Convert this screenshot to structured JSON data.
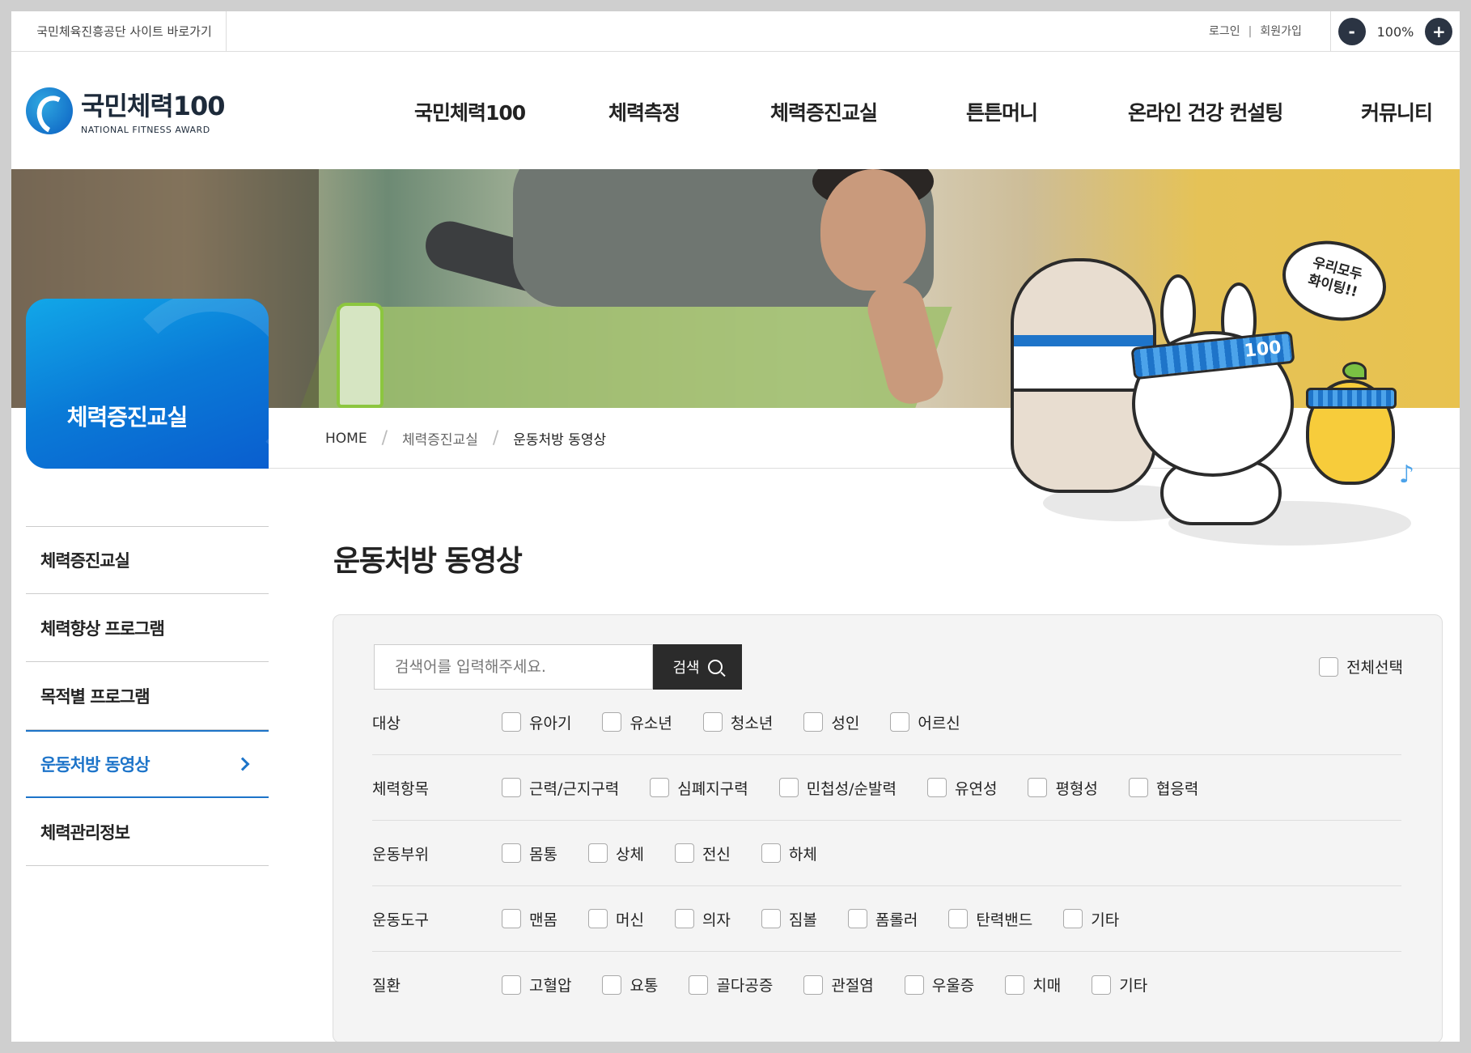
{
  "util": {
    "family_link": "국민체육진흥공단 사이트 바로가기",
    "login": "로그인",
    "separator": "|",
    "join": "회원가입",
    "zoom_out": "-",
    "zoom_level": "100%",
    "zoom_in": "+"
  },
  "logo": {
    "title": "국민체력100",
    "subtitle": "NATIONAL FITNESS AWARD"
  },
  "gnb": [
    "국민체력100",
    "체력측정",
    "체력증진교실",
    "튼튼머니",
    "온라인 건강 컨설팅",
    "커뮤니티"
  ],
  "visual": {
    "bubble_line1": "우리모두",
    "bubble_line2": "화이팅!!",
    "headband_text": "100"
  },
  "section_title": "체력증진교실",
  "breadcrumb": {
    "home": "HOME",
    "mid": "체력증진교실",
    "current": "운동처방 동영상"
  },
  "lnb": [
    {
      "label": "체력증진교실",
      "active": false
    },
    {
      "label": "체력향상 프로그램",
      "active": false
    },
    {
      "label": "목적별 프로그램",
      "active": false
    },
    {
      "label": "운동처방 동영상",
      "active": true
    },
    {
      "label": "체력관리정보",
      "active": false
    }
  ],
  "page_title": "운동처방 동영상",
  "search": {
    "placeholder": "검색어를 입력해주세요.",
    "button": "검색",
    "select_all": "전체선택"
  },
  "filters": [
    {
      "label": "대상",
      "options": [
        "유아기",
        "유소년",
        "청소년",
        "성인",
        "어르신"
      ]
    },
    {
      "label": "체력항목",
      "options": [
        "근력/근지구력",
        "심폐지구력",
        "민첩성/순발력",
        "유연성",
        "평형성",
        "협응력"
      ]
    },
    {
      "label": "운동부위",
      "options": [
        "몸통",
        "상체",
        "전신",
        "하체"
      ]
    },
    {
      "label": "운동도구",
      "options": [
        "맨몸",
        "머신",
        "의자",
        "짐볼",
        "폼롤러",
        "탄력밴드",
        "기타"
      ]
    },
    {
      "label": "질환",
      "options": [
        "고혈압",
        "요통",
        "골다공증",
        "관절염",
        "우울증",
        "치매",
        "기타"
      ]
    }
  ],
  "colors": {
    "accent": "#1d74c9",
    "dark_button": "#2b2b2b",
    "zoom_button": "#2b3443"
  }
}
